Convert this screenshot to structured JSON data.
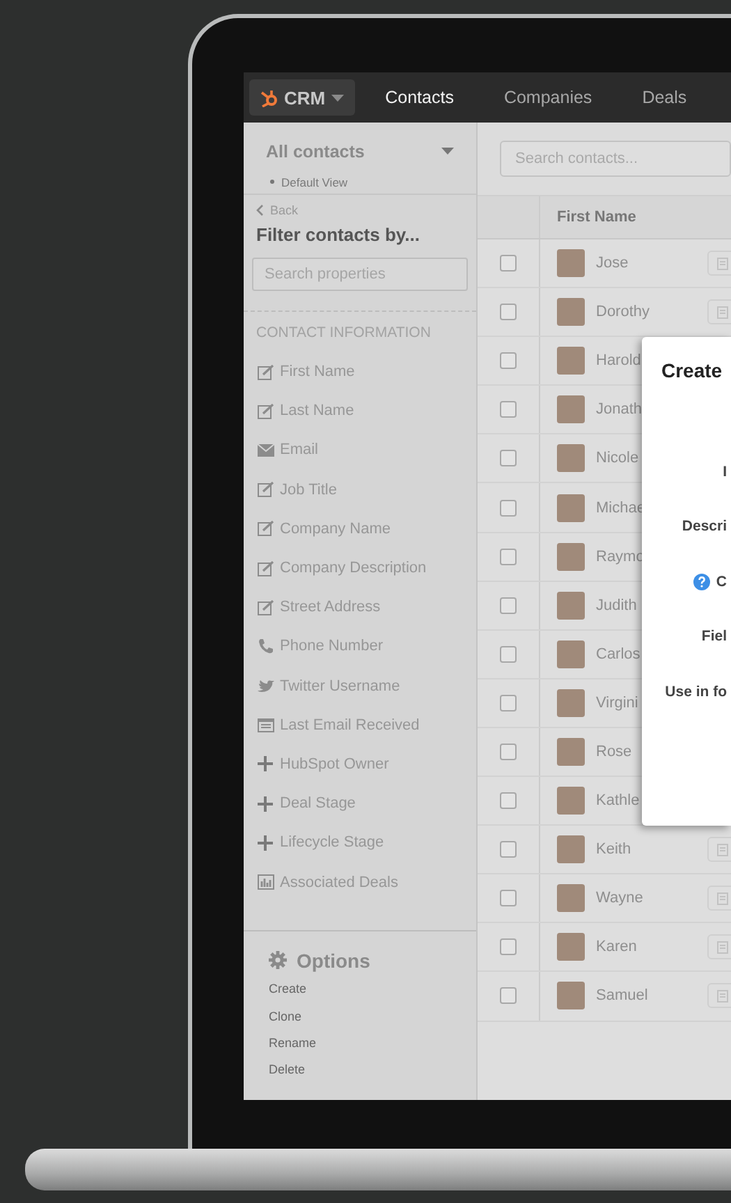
{
  "nav": {
    "logo": "CRM",
    "tabs": [
      {
        "label": "Contacts",
        "selected": true
      },
      {
        "label": "Companies",
        "selected": false
      },
      {
        "label": "Deals",
        "selected": false
      }
    ]
  },
  "sidebar": {
    "view_title": "All contacts",
    "view_subtitle": "Default View",
    "back": "Back",
    "heading": "Filter contacts by...",
    "search": {
      "placeholder": "Search properties"
    },
    "section": "CONTACT INFORMATION",
    "properties": [
      {
        "label": "First Name",
        "kind": "text"
      },
      {
        "label": "Last Name",
        "kind": "text"
      },
      {
        "label": "Email",
        "kind": "email"
      },
      {
        "label": "Job Title",
        "kind": "text"
      },
      {
        "label": "Company Name",
        "kind": "text"
      },
      {
        "label": "Company Description",
        "kind": "text"
      },
      {
        "label": "Street Address",
        "kind": "text"
      },
      {
        "label": "Phone Number",
        "kind": "phone"
      },
      {
        "label": "Twitter Username",
        "kind": "twitter"
      },
      {
        "label": "Last Email Received",
        "kind": "date"
      },
      {
        "label": "HubSpot Owner",
        "kind": "owner"
      },
      {
        "label": "Deal Stage",
        "kind": "owner"
      },
      {
        "label": "Lifecycle Stage",
        "kind": "owner"
      },
      {
        "label": "Associated Deals",
        "kind": "deals"
      }
    ],
    "options": {
      "title": "Options",
      "items": [
        "Create",
        "Clone",
        "Rename",
        "Delete"
      ]
    }
  },
  "table": {
    "search": {
      "placeholder": "Search contacts..."
    },
    "columns": [
      "First Name"
    ],
    "rows": [
      {
        "first_name": "Jose",
        "checked": false,
        "note_icon": true
      },
      {
        "first_name": "Dorothy",
        "checked": false,
        "note_icon": true
      },
      {
        "first_name": "Harold",
        "checked": false,
        "note_icon": false
      },
      {
        "first_name": "Jonath",
        "checked": false,
        "note_icon": false
      },
      {
        "first_name": "Nicole",
        "checked": false,
        "note_icon": false
      },
      {
        "first_name": "Michae",
        "checked": false,
        "note_icon": false
      },
      {
        "first_name": "Raymo",
        "checked": false,
        "note_icon": false
      },
      {
        "first_name": "Judith",
        "checked": false,
        "note_icon": false
      },
      {
        "first_name": "Carlos",
        "checked": false,
        "note_icon": false
      },
      {
        "first_name": "Virgini",
        "checked": false,
        "note_icon": false
      },
      {
        "first_name": "Rose",
        "checked": false,
        "note_icon": false
      },
      {
        "first_name": "Kathle",
        "checked": false,
        "note_icon": false
      },
      {
        "first_name": "Keith",
        "checked": false,
        "note_icon": true
      },
      {
        "first_name": "Wayne",
        "checked": false,
        "note_icon": true
      },
      {
        "first_name": "Karen",
        "checked": false,
        "note_icon": true
      },
      {
        "first_name": "Samuel",
        "checked": false,
        "note_icon": true
      }
    ]
  },
  "modal": {
    "title": "Create",
    "fields": [
      {
        "label": "I",
        "help": false
      },
      {
        "label": "Descri",
        "help": false
      },
      {
        "label": "C",
        "help": true
      },
      {
        "label": "Fiel",
        "help": false
      },
      {
        "label": "Use in fo",
        "help": false
      }
    ]
  }
}
